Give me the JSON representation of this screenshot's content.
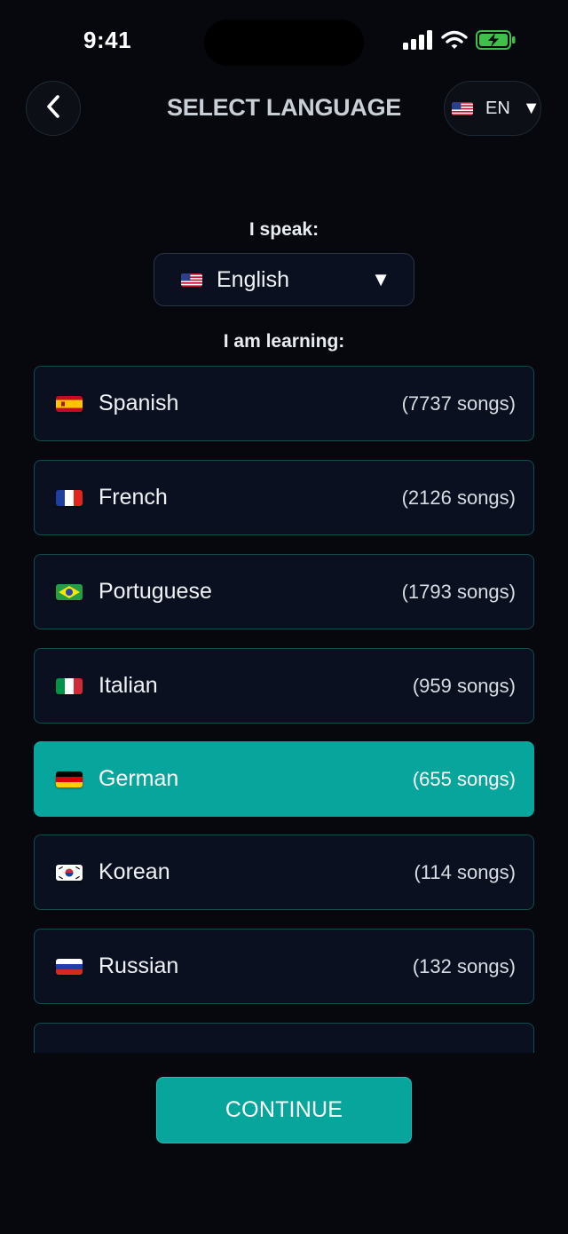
{
  "status": {
    "time": "9:41"
  },
  "header": {
    "title": "SELECT LANGUAGE",
    "ui_language_code": "EN"
  },
  "speak": {
    "label": "I speak:",
    "selected": "English",
    "flag": "us-flag"
  },
  "learning": {
    "label": "I am learning:",
    "items": [
      {
        "name": "Spanish",
        "count": "(7737 songs)",
        "flag": "es-flag",
        "selected": false
      },
      {
        "name": "French",
        "count": "(2126 songs)",
        "flag": "fr-flag",
        "selected": false
      },
      {
        "name": "Portuguese",
        "count": "(1793 songs)",
        "flag": "br-flag",
        "selected": false
      },
      {
        "name": "Italian",
        "count": "(959 songs)",
        "flag": "it-flag",
        "selected": false
      },
      {
        "name": "German",
        "count": "(655 songs)",
        "flag": "de-flag",
        "selected": true
      },
      {
        "name": "Korean",
        "count": "(114 songs)",
        "flag": "kr-flag",
        "selected": false
      },
      {
        "name": "Russian",
        "count": "(132 songs)",
        "flag": "ru-flag",
        "selected": false
      }
    ]
  },
  "actions": {
    "continue_label": "CONTINUE"
  },
  "colors": {
    "accent": "#08a59c",
    "background": "#06080d",
    "card": "#0b1020",
    "card_border": "#144c4e"
  }
}
